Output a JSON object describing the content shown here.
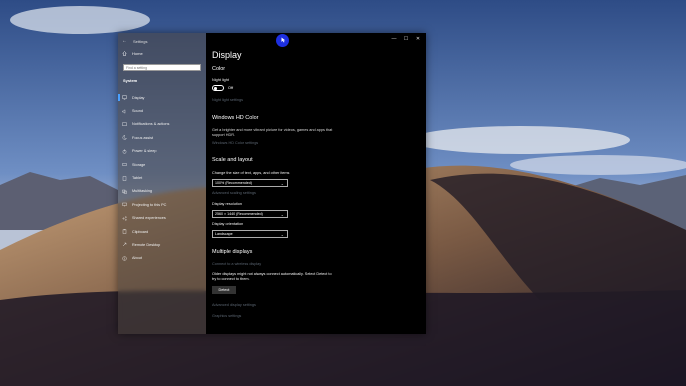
{
  "window": {
    "title": "Settings",
    "controls": {
      "minimize": "—",
      "maximize": "☐",
      "close": "✕"
    }
  },
  "nav": {
    "home_label": "Home",
    "search_placeholder": "Find a setting",
    "section_title": "System",
    "items": [
      {
        "label": "Display",
        "icon": "monitor-icon"
      },
      {
        "label": "Sound",
        "icon": "speaker-icon"
      },
      {
        "label": "Notifications & actions",
        "icon": "notification-icon"
      },
      {
        "label": "Focus assist",
        "icon": "moon-icon"
      },
      {
        "label": "Power & sleep",
        "icon": "power-icon"
      },
      {
        "label": "Storage",
        "icon": "storage-icon"
      },
      {
        "label": "Tablet",
        "icon": "tablet-icon"
      },
      {
        "label": "Multitasking",
        "icon": "multitasking-icon"
      },
      {
        "label": "Projecting to this PC",
        "icon": "projector-icon"
      },
      {
        "label": "Shared experiences",
        "icon": "share-icon"
      },
      {
        "label": "Clipboard",
        "icon": "clipboard-icon"
      },
      {
        "label": "Remote Desktop",
        "icon": "remote-icon"
      },
      {
        "label": "About",
        "icon": "info-icon"
      }
    ]
  },
  "content": {
    "page_title": "Display",
    "color_heading": "Color",
    "night_light_label": "Night light",
    "night_light_state": "Off",
    "night_light_settings_link": "Night light settings",
    "hd_color_heading": "Windows HD Color",
    "hd_color_desc": "Get a brighter and more vibrant picture for videos, games and apps that support HDR.",
    "hd_color_settings_link": "Windows HD Color settings",
    "scale_heading": "Scale and layout",
    "scale_label": "Change the size of text, apps, and other items",
    "scale_value": "100% (Recommended)",
    "advanced_scaling_link": "Advanced scaling settings",
    "resolution_label": "Display resolution",
    "resolution_value": "2560 × 1440 (Recommended)",
    "orientation_label": "Display orientation",
    "orientation_value": "Landscape",
    "multiple_heading": "Multiple displays",
    "wireless_link": "Connect to a wireless display",
    "multiple_desc": "Older displays might not always connect automatically. Select Detect to try to connect to them.",
    "detect_button": "Detect",
    "advanced_display_link": "Advanced display settings",
    "graphics_link": "Graphics settings"
  },
  "colors": {
    "accent": "#4aa0ff",
    "content_bg": "#000000",
    "cursor": "#1d2fe0"
  }
}
